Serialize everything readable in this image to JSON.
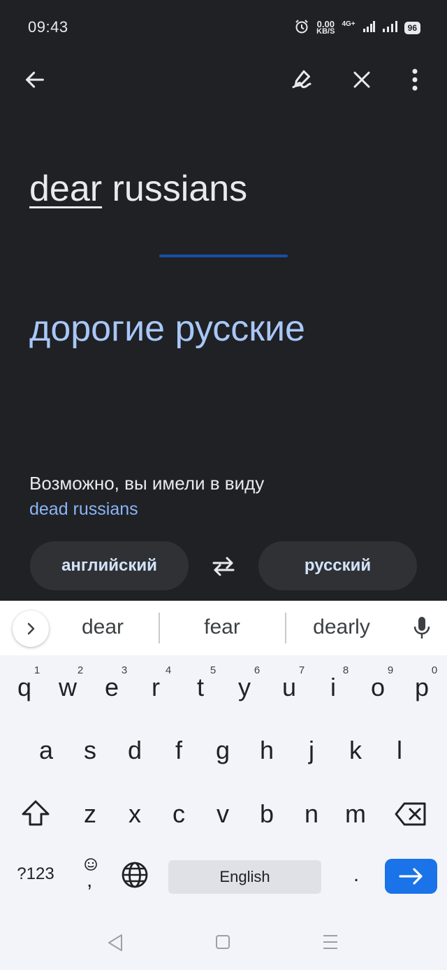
{
  "status_bar": {
    "time": "09:43",
    "net_speed_value": "0.00",
    "net_speed_unit": "KB/S",
    "network": "4G+",
    "battery": "96"
  },
  "translation": {
    "source_word_underlined": "dear",
    "source_rest": " russians",
    "target_text": "дорогие русские",
    "did_you_mean_label": "Возможно, вы имели в виду",
    "did_you_mean_suggestion": "dead russians"
  },
  "languages": {
    "source": "английский",
    "target": "русский"
  },
  "keyboard": {
    "suggestions": [
      "dear",
      "fear",
      "dearly"
    ],
    "row1": [
      "q",
      "w",
      "e",
      "r",
      "t",
      "y",
      "u",
      "i",
      "o",
      "p"
    ],
    "row1_hints": [
      "1",
      "2",
      "3",
      "4",
      "5",
      "6",
      "7",
      "8",
      "9",
      "0"
    ],
    "row2": [
      "a",
      "s",
      "d",
      "f",
      "g",
      "h",
      "j",
      "k",
      "l"
    ],
    "row3": [
      "z",
      "x",
      "c",
      "v",
      "b",
      "n",
      "m"
    ],
    "symbols_label": "?123",
    "comma": ",",
    "period": ".",
    "space_label": "English"
  }
}
